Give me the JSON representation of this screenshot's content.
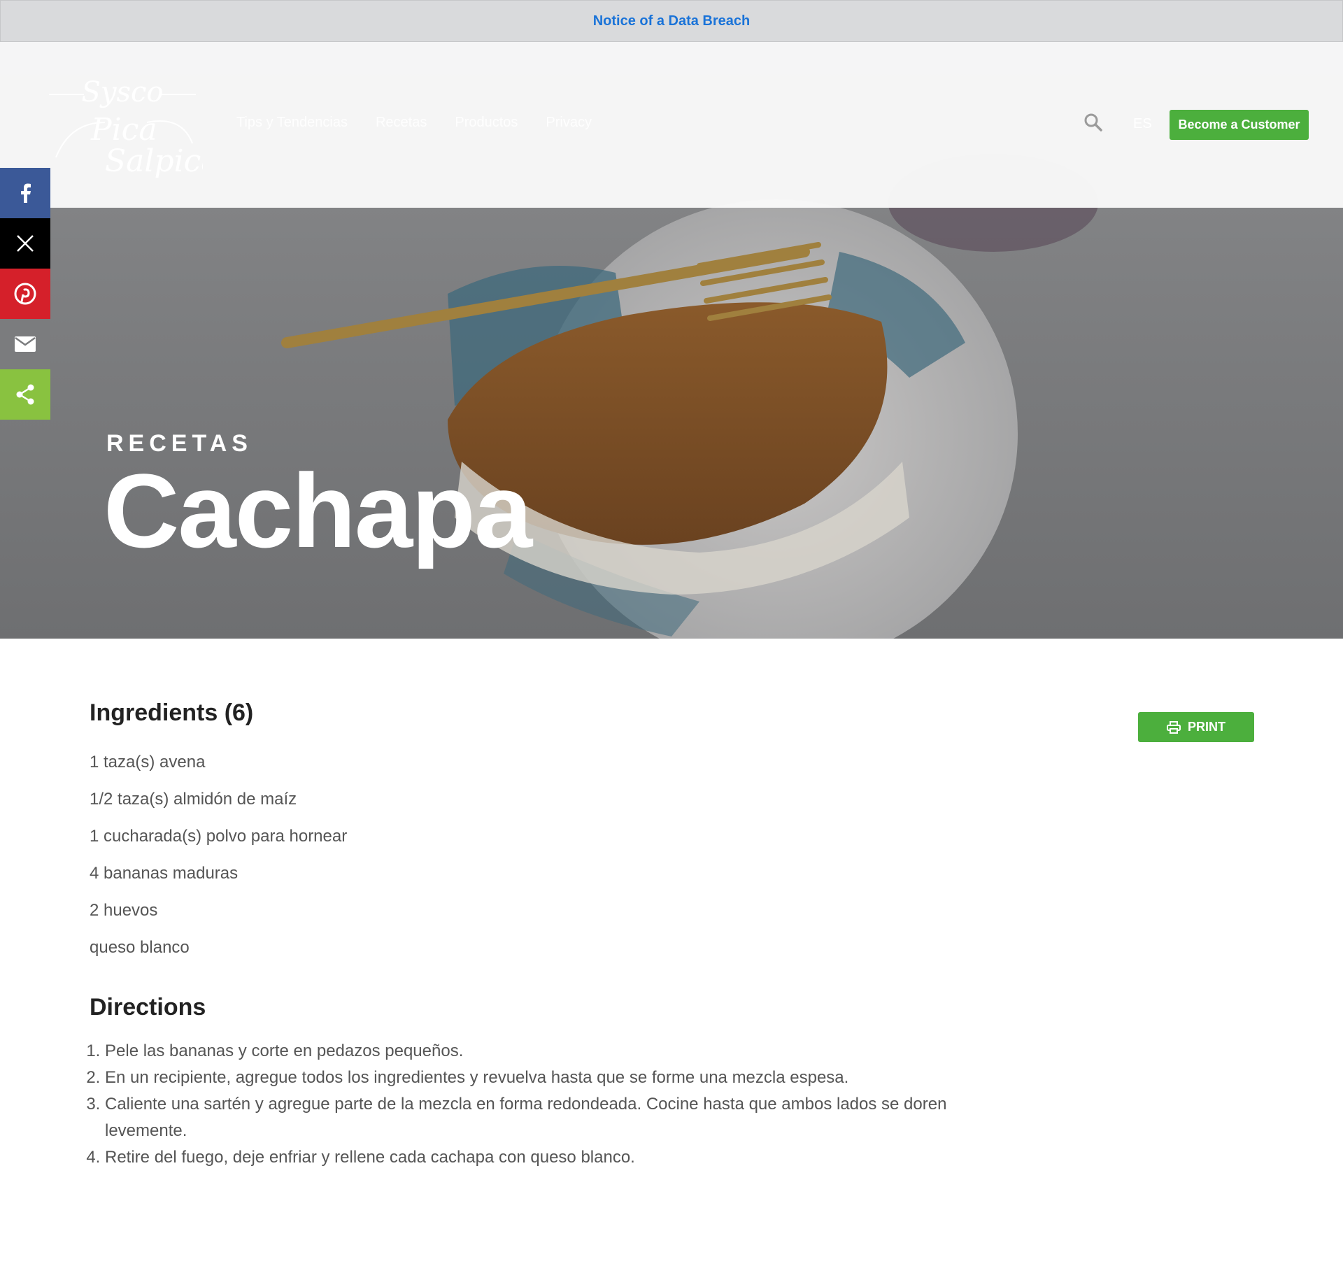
{
  "notice": {
    "text": "Notice of a Data Breach"
  },
  "header": {
    "logo_text_1": "Sysco",
    "logo_text_2": "Pica",
    "logo_text_3": "Salpica",
    "nav": [
      "Tips y Tendencias",
      "Recetas",
      "Productos",
      "Privacy"
    ],
    "language": "ES",
    "cta_label": "Become a Customer"
  },
  "hero": {
    "eyebrow": "RECETAS",
    "title": "Cachapa"
  },
  "social": [
    "facebook-icon",
    "x-icon",
    "pinterest-icon",
    "email-icon",
    "share-icon"
  ],
  "ingredients": {
    "title": "Ingredients (6)",
    "print_label": "PRINT",
    "items": [
      "1 taza(s) avena",
      "1/2 taza(s) almidón de maíz",
      "1 cucharada(s) polvo para hornear",
      "4 bananas maduras",
      "2 huevos",
      "queso blanco"
    ]
  },
  "directions": {
    "title": "Directions",
    "steps": [
      "Pele las bananas y corte en pedazos pequeños.",
      "En un recipiente, agregue todos los ingredientes y revuelva hasta que se forme una mezcla espesa.",
      "Caliente una sartén y agregue parte de la mezcla en forma redondeada. Cocine hasta que ambos lados se doren levemente.",
      "Retire del fuego, deje enfriar y rellene cada cachapa con queso blanco."
    ]
  },
  "colors": {
    "brand_green": "#4caf3d",
    "notice_link": "#1a73d8",
    "facebook": "#3b5998",
    "pinterest": "#d5202a",
    "share": "#89c240"
  }
}
